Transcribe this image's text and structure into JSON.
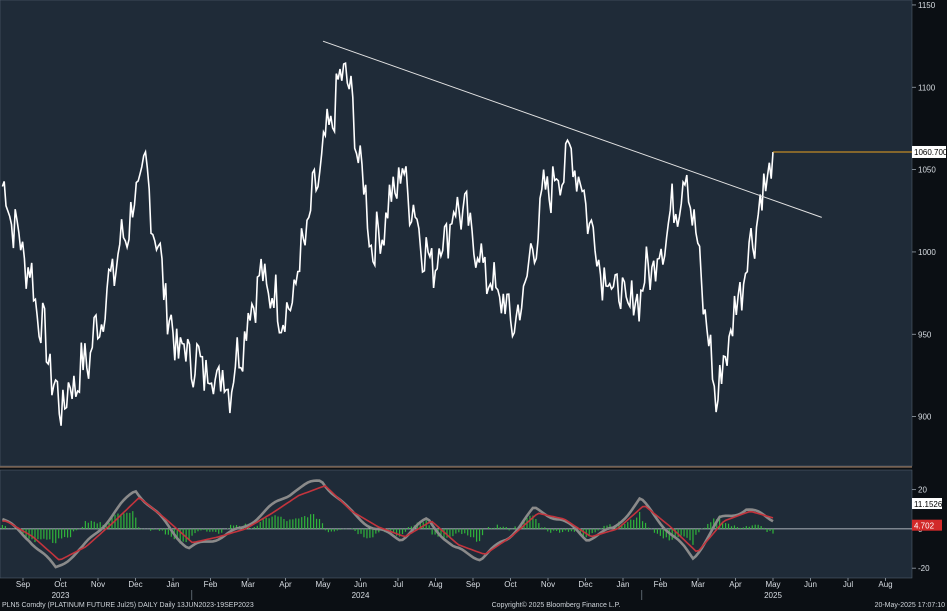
{
  "chart_data": [
    {
      "type": "line",
      "title": "",
      "ylim": [
        870,
        1153
      ],
      "y_ticks": [
        "1150",
        "1100",
        "1050",
        "1000",
        "950",
        "900"
      ],
      "x_months": [
        "Sep",
        "Oct",
        "Nov",
        "Dec",
        "Jan",
        "Feb",
        "Mar",
        "Apr",
        "May",
        "Jun",
        "Jul",
        "Aug",
        "Sep",
        "Oct",
        "Nov",
        "Dec",
        "Jan",
        "Feb",
        "Mar",
        "Apr",
        "May",
        "Jun",
        "Jul",
        "Aug"
      ],
      "x_years": [
        {
          "label": "2023",
          "month_index": 1
        },
        {
          "label": "2024",
          "month_index": 9
        },
        {
          "label": "2025",
          "month_index": 20
        }
      ],
      "series": [
        {
          "values_monthly_approx": [
            1040,
            985,
            905,
            935,
            995,
            1050,
            945,
            930,
            920,
            985,
            960,
            1040,
            1115,
            1000,
            1050,
            990,
            1030,
            985,
            955,
            1035,
            1060,
            990,
            965,
            1000,
            1050,
            910,
            990,
            1060
          ],
          "color": "#ffffff"
        }
      ],
      "trendline": {
        "from": {
          "month_index": 8.0,
          "value": 1128
        },
        "to": {
          "month_index": 21.3,
          "value": 1021
        },
        "color": "#e3e3e3"
      },
      "last_price": {
        "label": "1060.7000",
        "value": 1060.7,
        "line_color": "#e8a020"
      },
      "grid": false
    },
    {
      "type": "area",
      "title": "",
      "ylim": [
        -25,
        30
      ],
      "y_ticks": [
        "20",
        "0",
        "-20"
      ],
      "series": [
        {
          "values_approx": [
            5,
            -5,
            -20,
            -10,
            5,
            20,
            5,
            -10,
            -5,
            0,
            10,
            20,
            25,
            10,
            0,
            -5,
            5,
            -10,
            -15,
            -5,
            10,
            5,
            -5,
            0,
            15,
            0,
            -15,
            5,
            10,
            5
          ],
          "color": "#8a8a8a"
        },
        {
          "values_approx": [
            4,
            -4,
            -16,
            -9,
            3,
            16,
            5,
            -7,
            -4,
            0,
            8,
            17,
            22,
            9,
            1,
            -4,
            4,
            -8,
            -13,
            -4,
            8,
            5,
            -4,
            0,
            12,
            1,
            -12,
            4,
            9,
            5
          ],
          "color": "#c3343d"
        },
        {
          "values_approx": [
            1,
            -1,
            -4,
            -1,
            2,
            4,
            0,
            -3,
            -1,
            0,
            2,
            3,
            3,
            1,
            -1,
            -1,
            1,
            -2,
            -2,
            -1,
            2,
            0,
            -1,
            0,
            3,
            -1,
            -3,
            1,
            1,
            0
          ],
          "color": "#2fb53a"
        }
      ],
      "tags": [
        {
          "label": "11.1526",
          "value": 11.1526,
          "bg": "#ffffff",
          "fg": "#000000"
        },
        {
          "label": "4.702",
          "value": 4.702,
          "bg": "#d22a2a",
          "fg": "#ffffff"
        }
      ]
    }
  ],
  "footer": {
    "left": "PLN5 Comdty (PLATINUM FUTURE  Jul25) DAILY  Daily 13JUN2023-19SEP2023",
    "center": "Copyright© 2025 Bloomberg Finance L.P.",
    "right": "20-May-2025 17:07:10"
  }
}
